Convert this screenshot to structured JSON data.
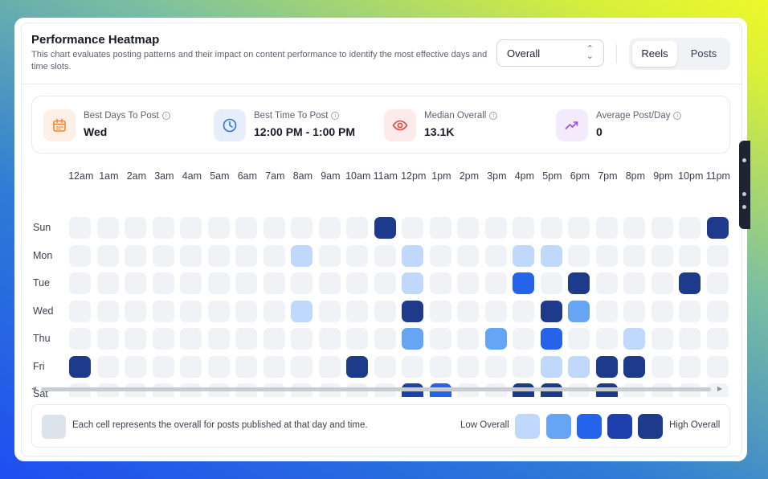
{
  "header": {
    "title": "Performance Heatmap",
    "subtitle": "This chart evaluates posting patterns and their impact on content performance to identify the most effective days and time slots.",
    "metric_select": "Overall",
    "tabs": [
      {
        "label": "Reels",
        "active": true
      },
      {
        "label": "Posts",
        "active": false
      }
    ]
  },
  "stats": [
    {
      "label": "Best Days To Post",
      "value": "Wed",
      "icon": "calendar-icon",
      "color": "#f0883a",
      "bg": "#fdf0e6"
    },
    {
      "label": "Best Time To Post",
      "value": "12:00 PM - 1:00 PM",
      "icon": "clock-icon",
      "color": "#2f6fe0",
      "bg": "#e6eefc"
    },
    {
      "label": "Median Overall",
      "value": "13.1K",
      "icon": "eye-icon",
      "color": "#e2453c",
      "bg": "#fdeaea"
    },
    {
      "label": "Average Post/Day",
      "value": "0",
      "icon": "trending-up-icon",
      "color": "#9b4fdc",
      "bg": "#f3eafc"
    }
  ],
  "heatmap": {
    "hours": [
      "12am",
      "1am",
      "2am",
      "3am",
      "4am",
      "5am",
      "6am",
      "7am",
      "8am",
      "9am",
      "10am",
      "11am",
      "12pm",
      "1pm",
      "2pm",
      "3pm",
      "4pm",
      "5pm",
      "6pm",
      "7pm",
      "8pm",
      "9pm",
      "10pm",
      "11pm"
    ],
    "days": [
      "Sun",
      "Mon",
      "Tue",
      "Wed",
      "Thu",
      "Fri",
      "Sat"
    ],
    "levels": [
      [
        0,
        0,
        0,
        0,
        0,
        0,
        0,
        0,
        0,
        0,
        0,
        5,
        0,
        0,
        0,
        0,
        0,
        0,
        0,
        0,
        0,
        0,
        0,
        5
      ],
      [
        0,
        0,
        0,
        0,
        0,
        0,
        0,
        0,
        1,
        0,
        0,
        0,
        1,
        0,
        0,
        0,
        1,
        1,
        0,
        0,
        0,
        0,
        0,
        0
      ],
      [
        0,
        0,
        0,
        0,
        0,
        0,
        0,
        0,
        0,
        0,
        0,
        0,
        1,
        0,
        0,
        0,
        3,
        0,
        5,
        0,
        0,
        0,
        5,
        0
      ],
      [
        0,
        0,
        0,
        0,
        0,
        0,
        0,
        0,
        1,
        0,
        0,
        0,
        5,
        0,
        0,
        0,
        0,
        5,
        2,
        0,
        0,
        0,
        0,
        0
      ],
      [
        0,
        0,
        0,
        0,
        0,
        0,
        0,
        0,
        0,
        0,
        0,
        0,
        2,
        0,
        0,
        2,
        0,
        3,
        0,
        0,
        1,
        0,
        0,
        0
      ],
      [
        5,
        0,
        0,
        0,
        0,
        0,
        0,
        0,
        0,
        0,
        5,
        0,
        0,
        0,
        0,
        0,
        0,
        1,
        1,
        5,
        5,
        0,
        0,
        0
      ],
      [
        0,
        0,
        0,
        0,
        0,
        0,
        0,
        0,
        0,
        0,
        0,
        0,
        4,
        3,
        0,
        0,
        5,
        5,
        0,
        5,
        0,
        0,
        0,
        0
      ]
    ],
    "colors": [
      "#f0f2f6",
      "#bfd8fb",
      "#65a5f4",
      "#2563eb",
      "#1e40af",
      "#1e3a8a"
    ]
  },
  "legend": {
    "note": "Each cell represents the overall for posts published at that day and time.",
    "low_label": "Low Overall",
    "high_label": "High Overall",
    "scale": [
      "#bfd8fb",
      "#65a5f4",
      "#2563eb",
      "#1e40af",
      "#1e3a8a"
    ]
  }
}
